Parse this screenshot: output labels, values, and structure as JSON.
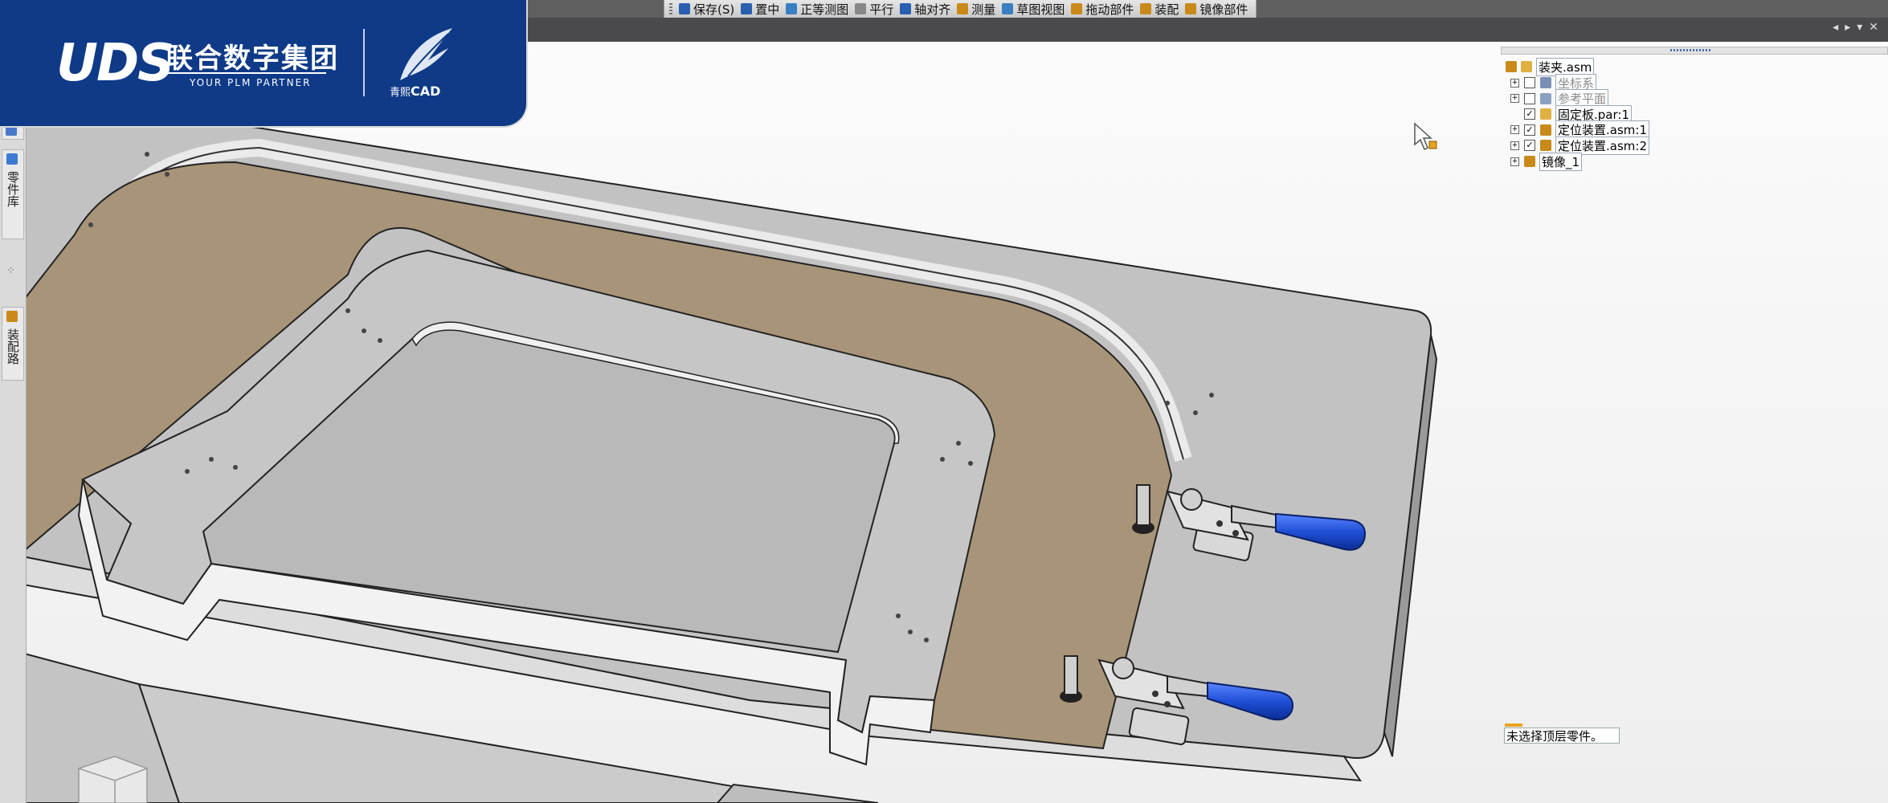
{
  "brand": {
    "logo": "UDS",
    "name_cn": "联合数字集团",
    "tagline": "YOUR PLM PARTNER",
    "cad_cn": "青熙",
    "cad_en": "CAD"
  },
  "toolbar": {
    "items": [
      {
        "label": "保存(S)",
        "icon": "save-icon",
        "color": "#2a5fb0"
      },
      {
        "label": "置中",
        "icon": "center-icon",
        "color": "#2a5fb0"
      },
      {
        "label": "正等测图",
        "icon": "iso-view-icon",
        "color": "#3a7fc0"
      },
      {
        "label": "平行",
        "icon": "parallel-icon",
        "color": "#888888"
      },
      {
        "label": "轴对齐",
        "icon": "axis-align-icon",
        "color": "#2a5fb0"
      },
      {
        "label": "测量",
        "icon": "measure-icon",
        "color": "#c98a1a"
      },
      {
        "label": "草图视图",
        "icon": "sketch-view-icon",
        "color": "#3a7fc0"
      },
      {
        "label": "拖动部件",
        "icon": "drag-part-icon",
        "color": "#c98a1a"
      },
      {
        "label": "装配",
        "icon": "assemble-icon",
        "color": "#c98a1a"
      },
      {
        "label": "镜像部件",
        "icon": "mirror-part-icon",
        "color": "#c98a1a"
      }
    ]
  },
  "side_tabs": [
    {
      "label": "零件库",
      "icon": "parts-library-icon"
    },
    {
      "label": "装配路",
      "icon": "assembly-path-icon"
    }
  ],
  "tree": {
    "root": "装夹.asm",
    "items": [
      {
        "label": "坐标系",
        "checked": false,
        "dim": true,
        "expand": true,
        "icon": "coordinate-system-icon"
      },
      {
        "label": "参考平面",
        "checked": false,
        "dim": true,
        "expand": true,
        "icon": "reference-plane-icon"
      },
      {
        "label": "固定板.par:1",
        "checked": true,
        "dim": false,
        "expand": false,
        "icon": "part-icon"
      },
      {
        "label": "定位装置.asm:1",
        "checked": true,
        "dim": false,
        "expand": true,
        "icon": "subassembly-icon"
      },
      {
        "label": "定位装置.asm:2",
        "checked": true,
        "dim": false,
        "expand": true,
        "icon": "subassembly-icon"
      }
    ],
    "mirror": "镜像_1"
  },
  "status": {
    "message": "未选择顶层零件。"
  },
  "colors": {
    "brand_blue": "#0e3a87",
    "plate_gray": "#c2c2c2",
    "wood": "#a89478",
    "handle_blue": "#1f4fd6"
  }
}
